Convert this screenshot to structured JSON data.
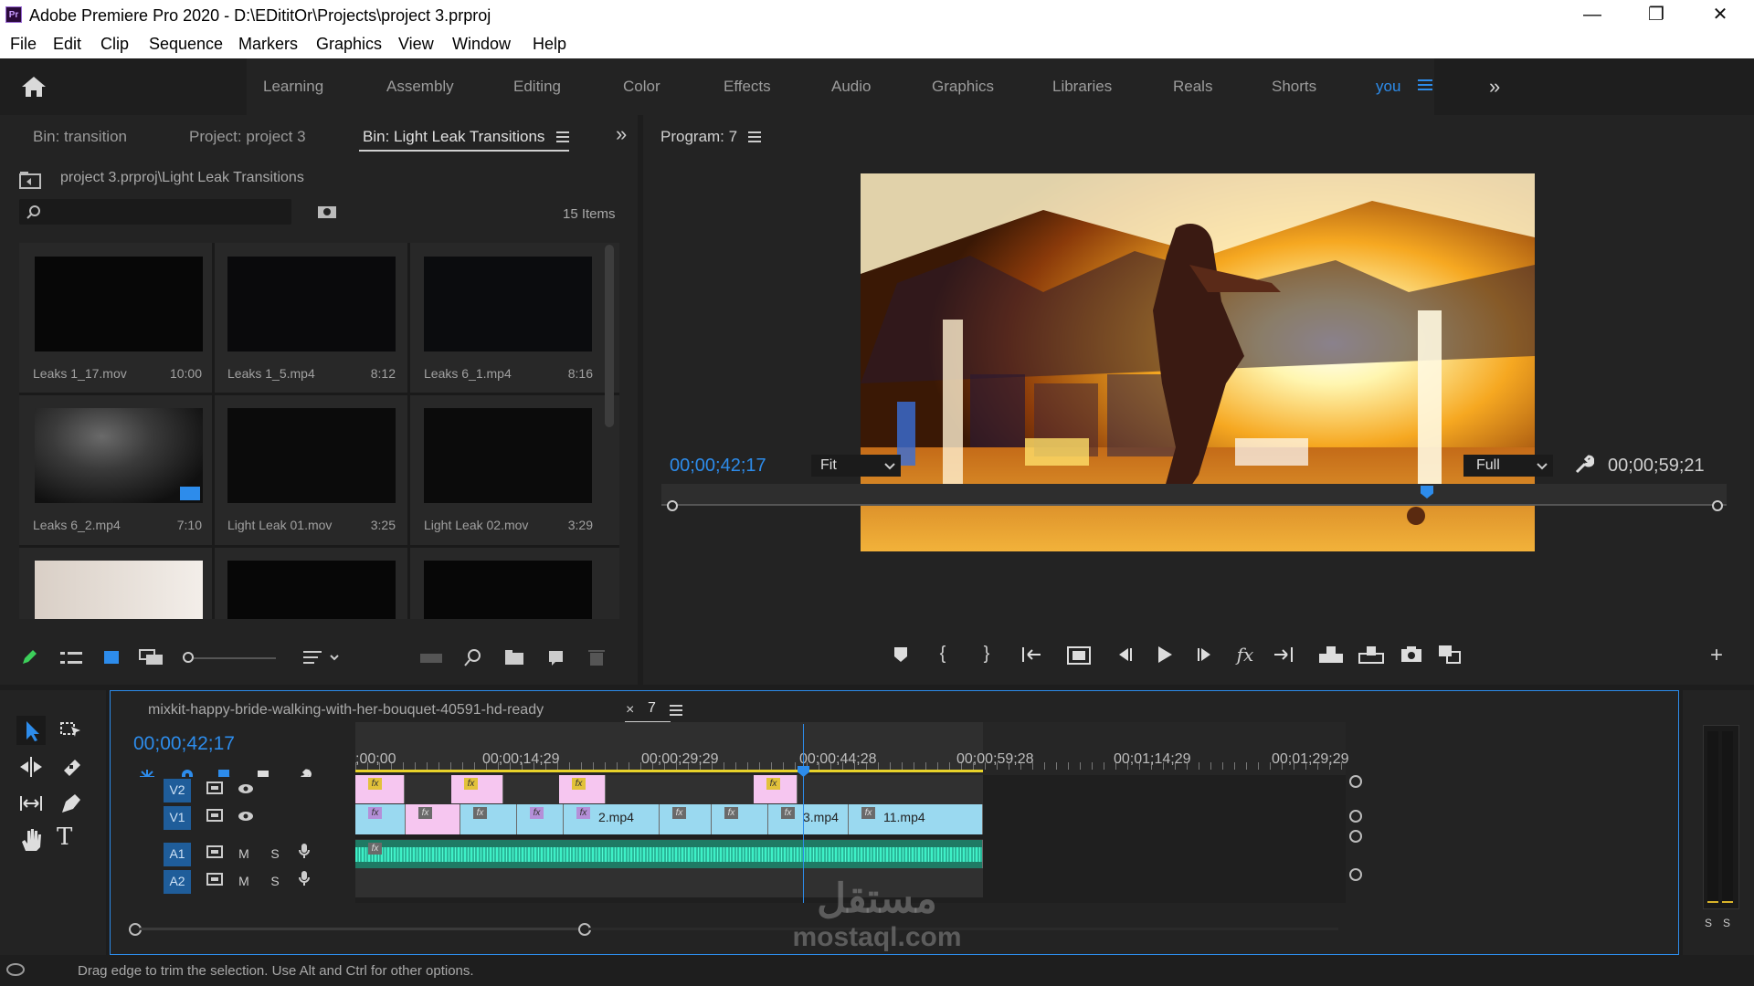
{
  "window": {
    "title": "Adobe Premiere Pro 2020 - D:\\EDititOr\\Projects\\project 3.prproj",
    "logo_text": "Pr",
    "minimize": "—",
    "maximize": "❐",
    "close": "✕"
  },
  "menu": [
    "File",
    "Edit",
    "Clip",
    "Sequence",
    "Markers",
    "Graphics",
    "View",
    "Window",
    "Help"
  ],
  "workspaces": [
    "Learning",
    "Assembly",
    "Editing",
    "Color",
    "Effects",
    "Audio",
    "Graphics",
    "Libraries",
    "Reals",
    "Shorts",
    "you"
  ],
  "active_workspace": "you",
  "project_panel": {
    "tabs": [
      "Bin: transition",
      "Project: project 3",
      "Bin: Light Leak Transitions"
    ],
    "path": "project 3.prproj\\Light Leak Transitions",
    "search_value": "",
    "item_count": "15 Items",
    "items": [
      {
        "name": "Leaks 1_17.mov",
        "duration": "10:00"
      },
      {
        "name": "Leaks 1_5.mp4",
        "duration": "8:12"
      },
      {
        "name": "Leaks 6_1.mp4",
        "duration": "8:16"
      },
      {
        "name": "Leaks 6_2.mp4",
        "duration": "7:10"
      },
      {
        "name": "Light Leak 01.mov",
        "duration": "3:25"
      },
      {
        "name": "Light Leak 02.mov",
        "duration": "3:29"
      }
    ]
  },
  "program_monitor": {
    "title": "Program: 7",
    "current_timecode": "00;00;42;17",
    "duration_timecode": "00;00;59;21",
    "zoom": "Fit",
    "resolution": "Full"
  },
  "timeline": {
    "sequence_tabs": [
      "mixkit-happy-bride-walking-with-her-bouquet-40591-hd-ready",
      "7"
    ],
    "close_glyph": "×",
    "timecode": "00;00;42;17",
    "ruler_labels": [
      ";00;00",
      "00;00;14;29",
      "00;00;29;29",
      "00;00;44;28",
      "00;00;59;28",
      "00;01;14;29",
      "00;01;29;29"
    ],
    "tracks": [
      {
        "id": "V2",
        "type": "video"
      },
      {
        "id": "V1",
        "type": "video"
      },
      {
        "id": "A1",
        "type": "audio"
      },
      {
        "id": "A2",
        "type": "audio"
      }
    ],
    "clip_labels": {
      "clip_2": "2.mp4",
      "clip_3": "3.mp4",
      "clip_11": "11.mp4"
    },
    "fx_label": "fx",
    "mute_label": "M",
    "solo_label": "S"
  },
  "meters": {
    "solo_left": "S",
    "solo_right": "S"
  },
  "status": {
    "message": "Drag edge to trim the selection. Use Alt and Ctrl for other options."
  },
  "watermark": {
    "text": "mostaql.com",
    "logo": "مستقل"
  },
  "colors": {
    "accent": "#2d8ceb",
    "video_clip": "#9ad9f0",
    "v2_clip": "#f6c6f0",
    "audio_clip": "#2bb89a",
    "playhead": "#2d8ceb"
  }
}
